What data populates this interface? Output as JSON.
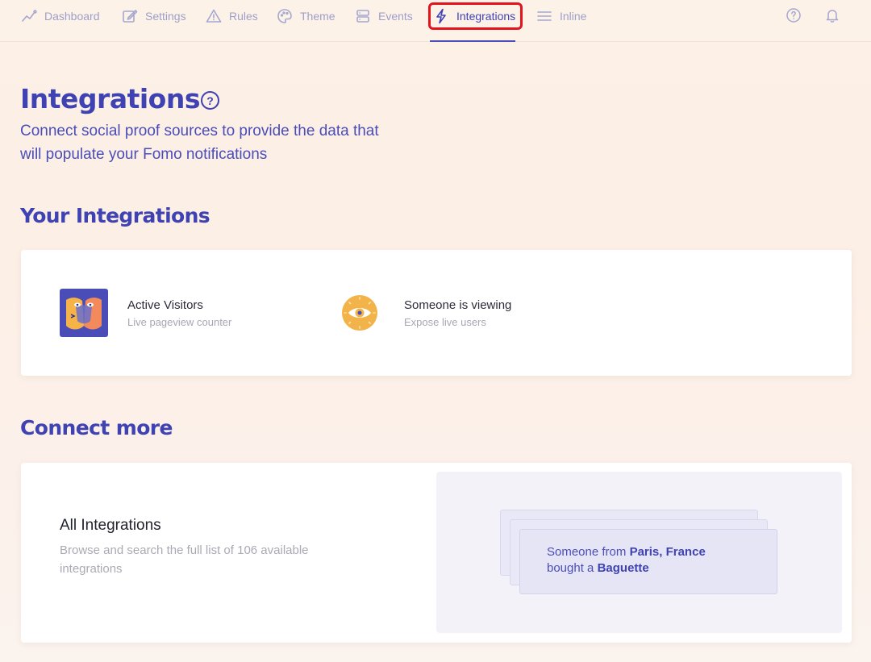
{
  "nav": {
    "items": [
      {
        "label": "Dashboard"
      },
      {
        "label": "Settings"
      },
      {
        "label": "Rules"
      },
      {
        "label": "Theme"
      },
      {
        "label": "Events"
      },
      {
        "label": "Integrations"
      },
      {
        "label": "Inline"
      }
    ],
    "active": "Integrations"
  },
  "page": {
    "title": "Integrations",
    "help_symbol": "?",
    "subtitle": "Connect social proof sources to provide the data that will populate your Fomo notifications"
  },
  "your_integrations": {
    "heading": "Your Integrations",
    "items": [
      {
        "name": "Active Visitors",
        "description": "Live pageview counter"
      },
      {
        "name": "Someone is viewing",
        "description": "Expose live users"
      }
    ]
  },
  "connect_more": {
    "heading": "Connect more",
    "all": {
      "title": "All Integrations",
      "description": "Browse and search the full list of 106 available integrations"
    },
    "preview": {
      "prefix": "Someone from",
      "location": "Paris, France",
      "action": "bought a",
      "product": "Baguette"
    }
  },
  "colors": {
    "brand": "#3f42b3",
    "active_highlight": "#e3141d",
    "background": "#fdf1e6"
  }
}
